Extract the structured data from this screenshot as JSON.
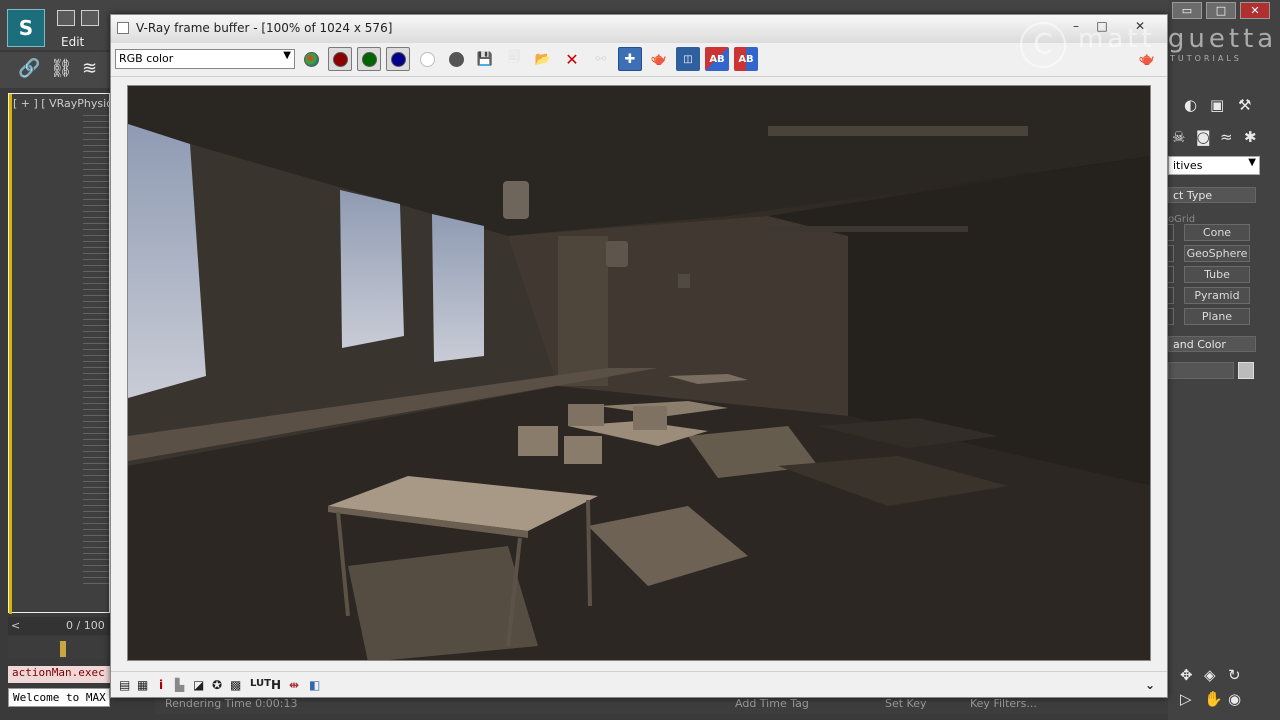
{
  "app": {
    "logo_text": "S",
    "menu_edit": "Edit",
    "viewport_label": "[ + ] [ VRayPhysic",
    "timeline_frames": "0 / 100",
    "timeline_arrow": "<",
    "maxscript_text": "actionMan.exec",
    "listener_text": "Welcome to MAX",
    "status_rendering": "Rendering Time 0:00:13",
    "status_add_tag": "Add Time Tag",
    "status_setkey": "Set Key",
    "status_keyfilters": "Key Filters..."
  },
  "command_panel": {
    "dropdown": "itives",
    "object_type_header": "ct Type",
    "autogrid": "oGrid",
    "buttons": [
      "Cone",
      "GeoSphere",
      "Tube",
      "Pyramid",
      "Plane"
    ],
    "name_color_header": "and Color"
  },
  "window_controls": {
    "minimize": "▭",
    "maximize": "□",
    "close": "✕"
  },
  "vfb": {
    "title": "V-Ray frame buffer - [100% of 1024 x 576]",
    "channel": "RGB color",
    "channel_arrow": "▼",
    "minimize": "–",
    "maximize": "□",
    "close": "✕",
    "bottom_arrow": "⌄"
  },
  "watermark": {
    "logo": "C",
    "name": "matt guetta",
    "sub": "TUTORIALS"
  },
  "colors": {
    "accent_selected": "#3e6fb5",
    "red_channel": "#8b0000",
    "green_channel": "#006400",
    "blue_channel": "#00008b"
  }
}
